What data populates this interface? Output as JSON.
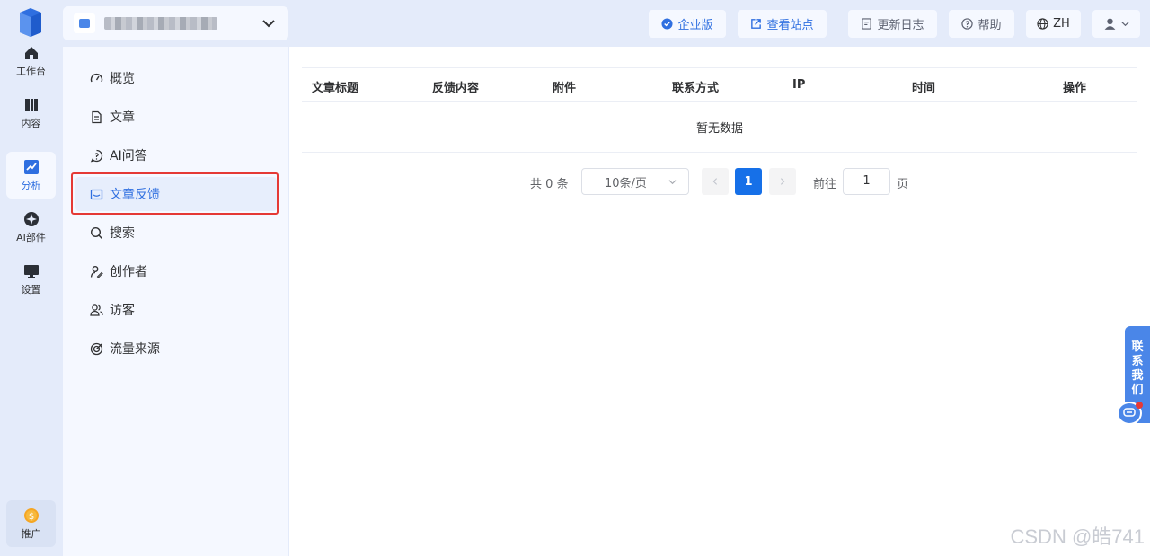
{
  "rail": {
    "items": [
      {
        "label": "工作台",
        "icon": "home-icon"
      },
      {
        "label": "内容",
        "icon": "book-icon"
      },
      {
        "label": "分析",
        "icon": "chart-icon",
        "active": true
      },
      {
        "label": "AI部件",
        "icon": "ai-widget-icon"
      },
      {
        "label": "设置",
        "icon": "monitor-icon"
      }
    ],
    "promo_label": "推广"
  },
  "header": {
    "buttons": {
      "enterprise": "企业版",
      "view_site": "查看站点",
      "changelog": "更新日志",
      "help": "帮助",
      "language": "ZH"
    }
  },
  "subnav": {
    "items": [
      {
        "label": "概览",
        "icon": "gauge-icon"
      },
      {
        "label": "文章",
        "icon": "document-icon"
      },
      {
        "label": "AI问答",
        "icon": "question-icon"
      },
      {
        "label": "文章反馈",
        "icon": "feedback-icon",
        "active": true
      },
      {
        "label": "搜索",
        "icon": "search-icon"
      },
      {
        "label": "创作者",
        "icon": "author-icon"
      },
      {
        "label": "访客",
        "icon": "visitors-icon"
      },
      {
        "label": "流量来源",
        "icon": "target-icon"
      }
    ]
  },
  "table": {
    "columns": [
      "文章标题",
      "反馈内容",
      "附件",
      "联系方式",
      "IP",
      "时间",
      "操作"
    ],
    "empty_text": "暂无数据"
  },
  "pagination": {
    "total": "共 0 条",
    "page_size": "10条/页",
    "current_page": "1",
    "goto_label": "前往",
    "goto_value": "1",
    "page_unit": "页"
  },
  "contact": {
    "label_chars": [
      "联",
      "系",
      "我",
      "们"
    ]
  },
  "watermark": "CSDN @皓741",
  "colors": {
    "accent": "#2f6fe0",
    "page_bg": "#e4ebfa",
    "panel_bg": "#f5f8ff",
    "highlight": "#e53935"
  }
}
